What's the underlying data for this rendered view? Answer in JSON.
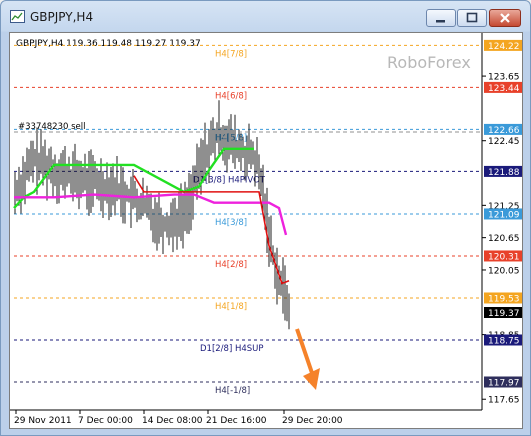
{
  "window": {
    "title": "GBPJPY,H4",
    "buttons": {
      "minimize": "minimize-icon",
      "maximize": "maximize-icon",
      "close": "close-icon"
    }
  },
  "chart_header": "GBPJPY,H4  119.36 119.48 119.27 119.37",
  "watermark": "RoboForex",
  "order_label": "#33748230 sell",
  "price_scale": [
    "123.65",
    "122.45",
    "121.25",
    "120.65",
    "120.05",
    "118.85",
    "117.65"
  ],
  "time_scale": [
    "29 Nov 2011",
    "7 Dec 00:00",
    "14 Dec 08:00",
    "21 Dec 16:00",
    "29 Dec 20:00"
  ],
  "levels": [
    {
      "label": "H4[7/8]",
      "price_tag": "124.22",
      "color": "#f4a520"
    },
    {
      "label": "H4[6/8]",
      "price_tag": "123.44",
      "color": "#e8412a"
    },
    {
      "label": "H4[5/8]",
      "price_tag": "122.66",
      "color": "#3a9ad9"
    },
    {
      "label": "D1[3/8] H4PIVOT",
      "price_tag": "121.88",
      "color": "#1a1a7a"
    },
    {
      "label": "H4[3/8]",
      "price_tag": "121.09",
      "color": "#3a9ad9"
    },
    {
      "label": "H4[2/8]",
      "price_tag": "120.31",
      "color": "#e8412a"
    },
    {
      "label": "H4[1/8]",
      "price_tag": "119.53",
      "color": "#f4a520"
    },
    {
      "label": "D1[2/8] H4SUP",
      "price_tag": "118.75",
      "color": "#1a1a7a"
    },
    {
      "label": "H4[-1/8]",
      "price_tag": "117.97",
      "color": "#2e2e5c"
    }
  ],
  "current_price_tag": "119.37",
  "colors": {
    "bars": "#1f1f1f",
    "green_line": "#22e022",
    "magenta_line": "#ee22dd",
    "red_line": "#e01010",
    "arrow": "#f5822a",
    "order_line": "#909090"
  },
  "chart_data": {
    "type": "line",
    "series": [
      {
        "color": "green",
        "x": [
          "29 Nov 2011",
          "7 Dec 00:00",
          "14 Dec 08:00",
          "21 Dec 16:00",
          "29 Dec 20:00"
        ],
        "points": [
          [
            0,
            121.2
          ],
          [
            10,
            121.4
          ],
          [
            20,
            121.5
          ],
          [
            40,
            122.0
          ],
          [
            70,
            122.0
          ],
          [
            120,
            122.0
          ],
          [
            170,
            121.5
          ],
          [
            185,
            121.6
          ],
          [
            195,
            121.9
          ],
          [
            210,
            122.3
          ],
          [
            240,
            122.3
          ]
        ]
      },
      {
        "color": "magenta",
        "points": [
          [
            0,
            121.4
          ],
          [
            40,
            121.4
          ],
          [
            80,
            121.45
          ],
          [
            120,
            121.4
          ],
          [
            160,
            121.45
          ],
          [
            180,
            121.45
          ],
          [
            200,
            121.3
          ],
          [
            255,
            121.3
          ],
          [
            265,
            121.2
          ],
          [
            272,
            120.7
          ]
        ]
      },
      {
        "color": "red",
        "points": [
          [
            120,
            121.8
          ],
          [
            130,
            121.5
          ],
          [
            175,
            121.5
          ],
          [
            245,
            121.5
          ],
          [
            255,
            120.5
          ],
          [
            268,
            119.8
          ],
          [
            275,
            119.85
          ]
        ]
      }
    ],
    "ylim": [
      117.45,
      124.45
    ]
  }
}
